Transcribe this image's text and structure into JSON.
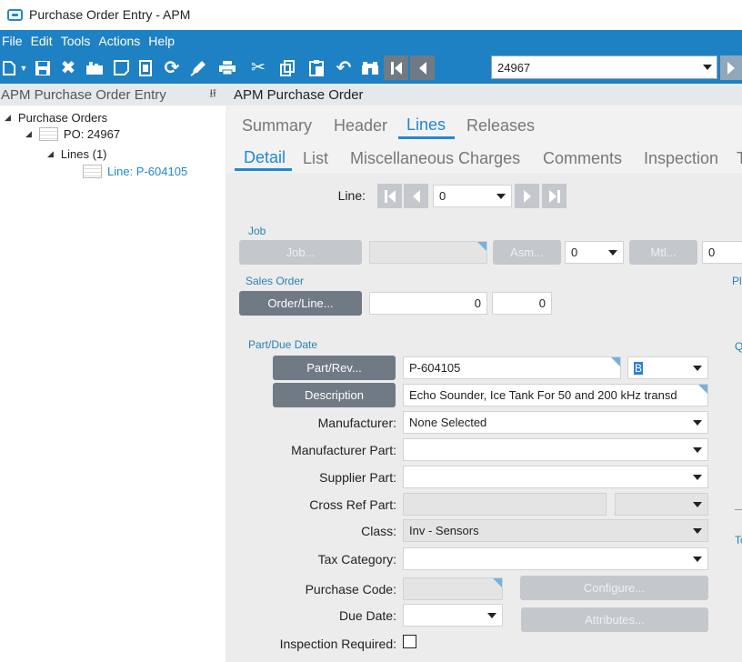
{
  "window": {
    "title": "Purchase Order Entry - APM"
  },
  "menu": [
    "File",
    "Edit",
    "Tools",
    "Actions",
    "Help"
  ],
  "toolbar": {
    "po_number": "24967"
  },
  "tree": {
    "header": "APM Purchase Order Entry",
    "pin": "⭿",
    "nodes": {
      "root": "Purchase Orders",
      "po": "PO: 24967",
      "lines": "Lines (1)",
      "line": "Line: P-604105"
    }
  },
  "panel": {
    "header": "APM Purchase Order",
    "tabs": [
      "Summary",
      "Header",
      "Lines",
      "Releases"
    ],
    "subtabs": [
      "Detail",
      "List",
      "Miscellaneous Charges",
      "Comments",
      "Inspection",
      "T"
    ]
  },
  "form": {
    "line_label": "Line:",
    "line_value": "0",
    "job_section": "Job",
    "job_button": "Job...",
    "asm_button": "Asm...",
    "asm_value": "0",
    "mtl_button": "Mtl...",
    "mtl_value": "0",
    "sales_section": "Sales Order",
    "order_button": "Order/Line...",
    "order_value": "0",
    "line_num_value": "0",
    "part_section": "Part/Due Date",
    "part_button": "Part/Rev...",
    "part_value": "P-604105",
    "rev_value": "B",
    "desc_button": "Description",
    "desc_value": "Echo Sounder, Ice Tank For 50 and 200 kHz transd",
    "manufacturer_label": "Manufacturer:",
    "manufacturer_value": "None Selected",
    "mfg_part_label": "Manufacturer Part:",
    "supplier_part_label": "Supplier Part:",
    "cross_ref_label": "Cross Ref Part:",
    "class_label": "Class:",
    "class_value": "Inv - Sensors",
    "tax_label": "Tax Category:",
    "purchase_code_label": "Purchase Code:",
    "configure_button": "Configure...",
    "due_date_label": "Due Date:",
    "attributes_button": "Attributes...",
    "inspection_label": "Inspection Required:",
    "side_texts": [
      "Pl",
      "Q",
      "To"
    ]
  }
}
